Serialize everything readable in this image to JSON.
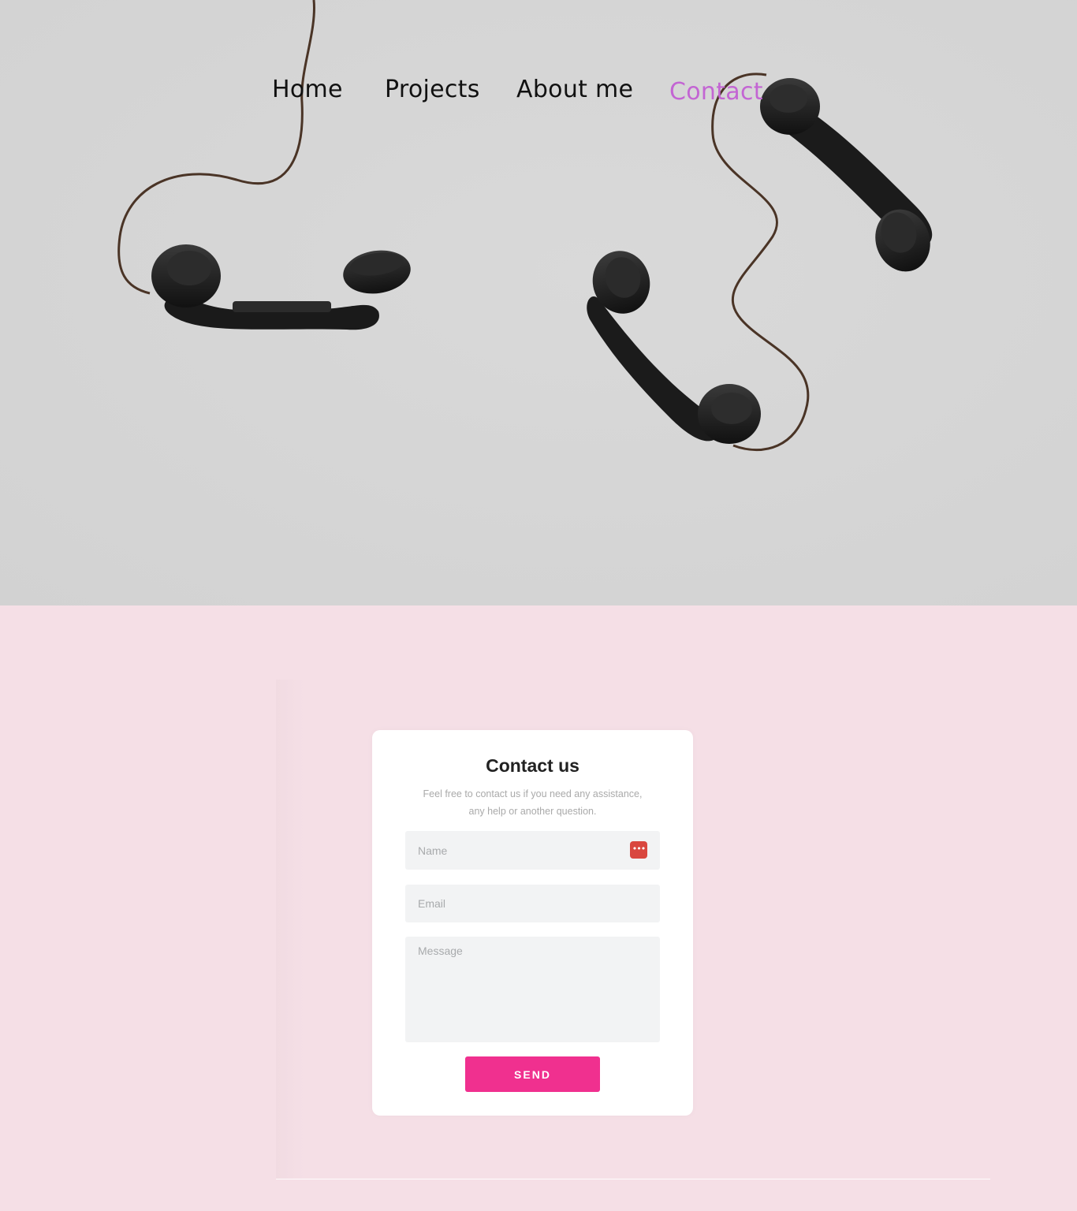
{
  "nav": {
    "items": [
      {
        "label": "Home",
        "active": false
      },
      {
        "label": "Projects",
        "active": false
      },
      {
        "label": "About me",
        "active": false
      },
      {
        "label": "Contact",
        "active": true
      }
    ],
    "active_color": "#c365d3"
  },
  "hero": {
    "image": "two-black-telephone-handsets-icon",
    "background_color": "#d5d5d5"
  },
  "contact_form": {
    "title": "Contact us",
    "subtitle_line1": "Feel free to contact us if you need any assistance,",
    "subtitle_line2": "any help or another question.",
    "name_placeholder": "Name",
    "email_placeholder": "Email",
    "message_placeholder": "Message",
    "send_label": "SEND",
    "button_color": "#f0308f",
    "autofill_icon": "password-manager-icon"
  },
  "section_background": "#f5dfe6"
}
